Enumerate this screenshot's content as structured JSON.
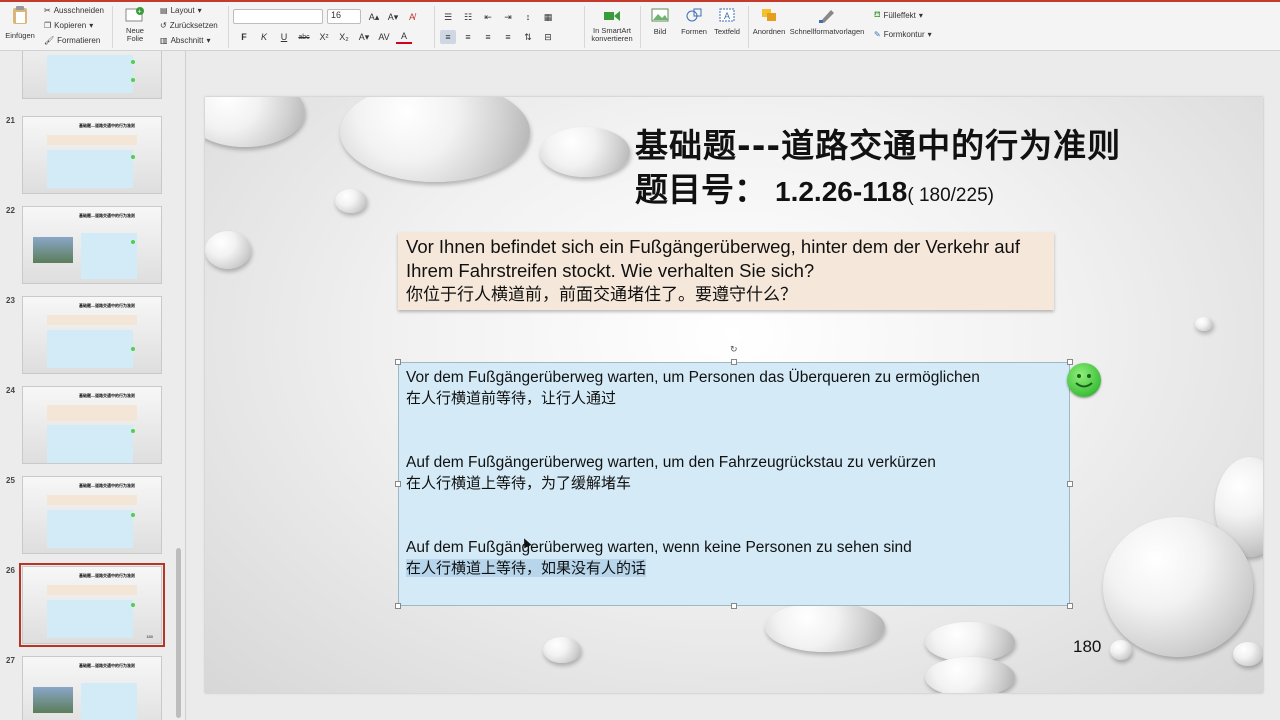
{
  "ribbon": {
    "paste": "Einfügen",
    "cut": "Ausschneiden",
    "copy": "Kopieren",
    "format_painter": "Formatieren",
    "new_slide": "Neue\nFolie",
    "layout": "Layout",
    "reset": "Zurücksetzen",
    "section": "Abschnitt",
    "font_name": "",
    "font_size": "16",
    "bold": "F",
    "italic": "K",
    "underline": "U",
    "strike": "abc",
    "superscript": "X²",
    "subscript": "X₂",
    "convert_smartart": "In SmartArt\nkonvertieren",
    "picture": "Bild",
    "shapes": "Formen",
    "textbox": "Textfeld",
    "arrange": "Anordnen",
    "quick_styles": "Schnellformatvorlagen",
    "fill": "Fülleffekt",
    "outline": "Formkontur"
  },
  "thumbnails": [
    {
      "num": "",
      "title": "",
      "selected": false
    },
    {
      "num": "21",
      "title": "基础题—道路交通中的行为准则",
      "selected": false
    },
    {
      "num": "22",
      "title": "基础题—道路交通中的行为准则",
      "selected": false
    },
    {
      "num": "23",
      "title": "基础题—道路交通中的行为准则",
      "selected": false
    },
    {
      "num": "24",
      "title": "基础题—道路交通中的行为准则",
      "selected": false
    },
    {
      "num": "25",
      "title": "基础题—道路交通中的行为准则",
      "selected": false
    },
    {
      "num": "26",
      "title": "基础题—道路交通中的行为准则",
      "selected": true
    },
    {
      "num": "27",
      "title": "基础题—道路交通中的行为准则",
      "selected": false
    }
  ],
  "slide": {
    "title_line1": "基础题---道路交通中的行为准则",
    "title_line2_prefix": "题目号：",
    "question_number": "1.2.26-118",
    "question_count": "( 180/225)",
    "question_de": "Vor Ihnen befindet sich ein Fußgängerüberweg, hinter dem der Verkehr auf Ihrem Fahrstreifen stockt. Wie verhalten Sie sich?",
    "question_cn": "你位于行人横道前，前面交通堵住了。要遵守什么？",
    "answers": [
      {
        "de": "Vor dem Fußgängerüberweg warten, um Personen das Überqueren zu ermöglichen",
        "cn": "在人行横道前等待，让行人通过",
        "correct": true
      },
      {
        "de": "Auf dem Fußgängerüberweg warten, um den Fahrzeugrückstau zu verkürzen",
        "cn": "在人行横道上等待，为了缓解堵车",
        "correct": false
      },
      {
        "de": "Auf dem Fußgängerüberweg warten, wenn keine Personen zu sehen sind",
        "cn": "在人行横道上等待，如果没有人的话",
        "correct": false
      }
    ],
    "page_number": "180"
  },
  "colors": {
    "accent_red": "#b73427",
    "question_bg": "#f5e7d9",
    "answer_bg": "#d4ebf7",
    "smiley_green": "#3fbf3a"
  }
}
